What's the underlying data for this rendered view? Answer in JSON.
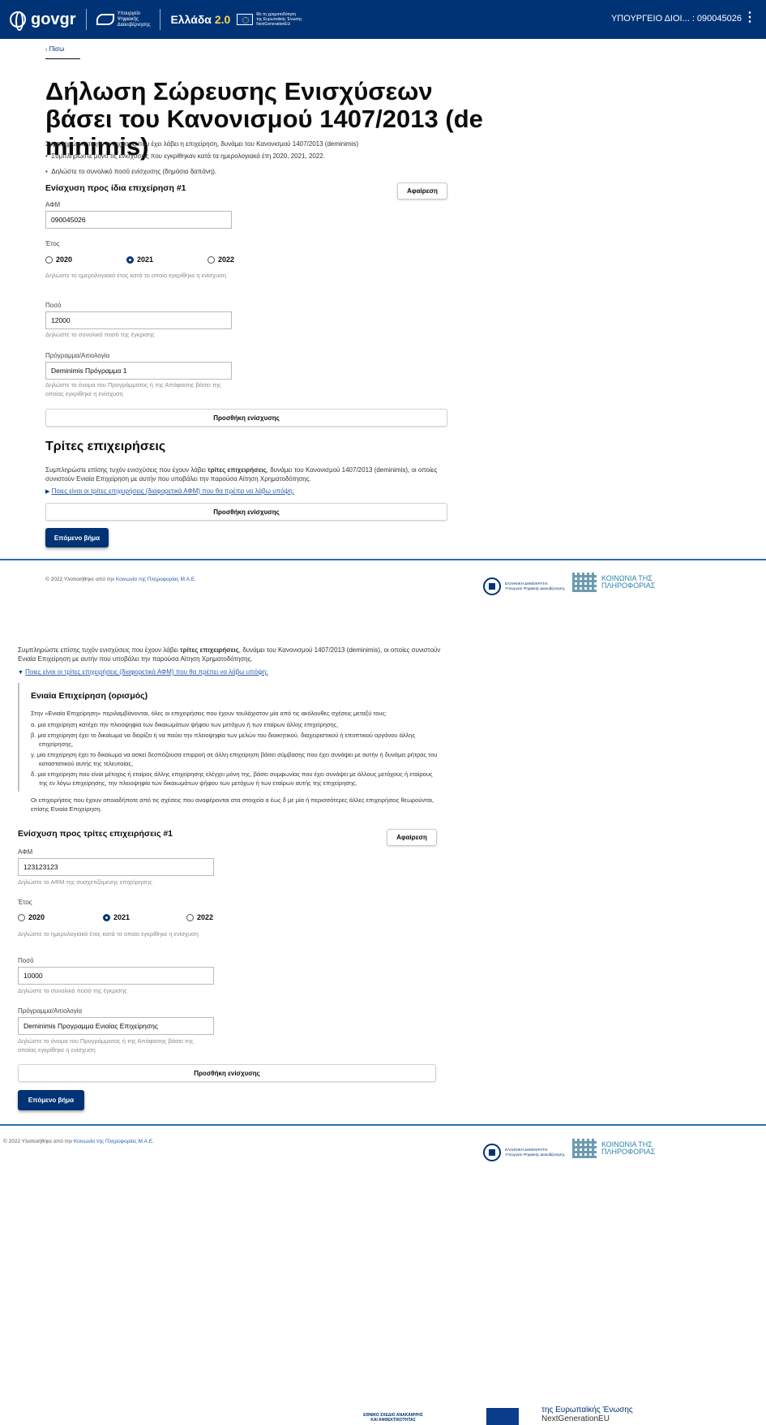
{
  "header": {
    "logo_text": "govgr",
    "mdg_line1": "Υπουργείο",
    "mdg_line2": "Ψηφιακής",
    "mdg_line3": "Διακυβέρνησης",
    "ellada_text": "Ελλάδα",
    "ellada_version": "2.0",
    "eu_line1": "Με τη χρηματοδότηση",
    "eu_line2": "της Ευρωπαϊκής Ένωσης",
    "eu_line3": "NextGenerationEU",
    "user_text": "ΥΠΟΥΡΓΕΙΟ ΔΙΟΙ... : 090045026"
  },
  "back_label": "Πίσω",
  "title": "Δήλωση Σώρευσης Ενισχύσεων βάσει του Κανονισμού 1407/2013 (de minimis)",
  "intro": {
    "text": "Συμπληρώστε τυχόν ενισχύσεις που έχει λάβει η επιχείρηση, δυνάμει του Κανονισμού 1407/2013 (deminimis)",
    "bullets": [
      "Συμπληρώστε μόνο τις ενισχύσεις που εγκρίθηκαν κατά τα ημερολογιακά έτη 2020, 2021, 2022.",
      "Δηλώστε το συνολικό ποσό ενίσχυσης (δημόσια δαπάνη)."
    ]
  },
  "own_aid": {
    "heading": "Ενίσχυση προς ίδια επιχείρηση #1",
    "remove_label": "Αφαίρεση",
    "afm_label": "ΑΦΜ",
    "afm_value": "090045026",
    "year_label": "Έτος",
    "years": [
      "2020",
      "2021",
      "2022"
    ],
    "year_selected": "2021",
    "year_hint": "Δηλώστε το ημερολογιακό έτος κατά το οποίο εγκρίθηκε η ενίσχυση",
    "amount_label": "Ποσό",
    "amount_value": "12000",
    "amount_hint": "Δηλώστε το συνολικό ποσό της έγκρισης",
    "program_label": "Πρόγραμμα/Αιτιολογία",
    "program_value": "Deminimis Πρόγραμμα 1",
    "program_hint": "Δηλώστε το όνομα του Προγράμματος ή της Απόφασης βάσει της οποίας εγκρίθηκε η ενίσχυση",
    "add_label": "Προσθήκη ενίσχυσης"
  },
  "third": {
    "heading": "Τρίτες επιχειρήσεις",
    "text_a": "Συμπληρώστε επίσης τυχόν ενισχύσεις που έχουν λάβει ",
    "text_bold": "τρίτες επιχειρήσεις",
    "text_b": ", δυνάμει του Κανονισμού 1407/2013 (deminimis), οι οποίες συνιστούν Ενιαία Επιχείρηση με αυτήν που υποβάλει την παρούσα Αίτηση Χρηματοδότησης.",
    "link": "Ποιες είναι οι τρίτες επιχειρήσεις (διαφορετικά ΑΦΜ) που θα πρέπει να λάβω υπόψη;",
    "add_label": "Προσθήκη ενίσχυσης"
  },
  "next_label": "Επόμενο βήμα",
  "footer": {
    "text": "© 2022 Υλοποιήθηκε από την ",
    "link": "Κοινωνία της Πληροφορίας Μ.Α.Ε.",
    "hd_line1": "ΕΛΛΗΝΙΚΗ ΔΗΜΟΚΡΑΤΙΑ",
    "hd_line2": "Υπουργείο Ψηφιακής Διακυβέρνησης",
    "kp_line1": "ΚΟΙΝΩΝΙΑ ΤΗΣ",
    "kp_line2": "ΠΛΗΡΟΦΟΡΙΑΣ"
  },
  "definition": {
    "heading": "Ενιαία Επιχείρηση (ορισμός)",
    "intro": "Στην «Ενιαία Επιχείρηση» περιλαμβάνονται, όλες οι επιχειρήσεις που έχουν τουλάχιστον μία από τις ακόλουθες σχέσεις μεταξύ τους:",
    "a": "α. μια επιχείρηση κατέχει την πλειοψηφία των δικαιωμάτων ψήφου των μετόχων ή των εταίρων άλλης επιχείρησης,",
    "b": "β. μια επιχείρηση έχει το δικαίωμα να διορίζει ή να παύει την πλειοψηφία των μελών του διοικητικού, διαχειριστικού ή εποπτικού οργάνου άλλης επιχείρησης,",
    "c": "γ. μια επιχείρηση έχει το δικαίωμα να ασκεί δεσπόζουσα επιρροή σε άλλη επιχείρηση βάσει σύμβασης που έχει συνάψει με αυτήν ή δυνάμει ρήτρας του καταστατικού αυτής της τελευταίας,",
    "d": "δ. μια επιχείρηση που είναι μέτοχος ή εταίρος άλλης επιχείρησης ελέγχει μόνη της, βάσει συμφωνίας που έχει συνάψει με άλλους μετόχους ή εταίρους της εν λόγω επιχείρησης, την πλειοψηφία των δικαιωμάτων ψήφου των μετόχων ή των εταίρων αυτής της επιχείρησης.",
    "outro": "Οι επιχειρήσεις που έχουν οποιαδήποτε από τις σχέσεις που αναφέρονται στα στοιχεία α έως δ με μία ή περισσότερες άλλες επιχειρήσεις θεωρούνται, επίσης Ενιαία Επιχείρηση."
  },
  "third_aid": {
    "heading": "Ενίσχυση προς τρίτες επιχειρήσεις #1",
    "remove_label": "Αφαίρεση",
    "afm_label": "ΑΦΜ",
    "afm_value": "123123123",
    "afm_hint": "Δηλώστε το ΑΦΜ της συσχετιζόμενης επιχείρησης",
    "year_label": "Έτος",
    "years": [
      "2020",
      "2021",
      "2022"
    ],
    "year_selected": "2021",
    "year_hint": "Δηλώστε το ημερολογιακό έτος κατά το οποίο εγκρίθηκε η ενίσχυση",
    "amount_label": "Ποσό",
    "amount_value": "10000",
    "amount_hint": "Δηλώστε το συνολικό ποσό της έγκρισης",
    "program_label": "Πρόγραμμα/Αιτιολογία",
    "program_value": "Deminimis Προγραμμα Ενιαίας Επιχείρησης",
    "program_hint": "Δηλώστε το όνομα του Προγράμματος ή της Απόφασης βάσει της οποίας εγκρίθηκε η ενίσχυση",
    "add_label": "Προσθήκη ενίσχυσης"
  },
  "bottom": {
    "rrf_line1": "ΕΘΝΙΚΟ ΣΧΕΔΙΟ ΑΝΑΚΑΜΨΗΣ",
    "rrf_line2": "ΚΑΙ ΑΝΘΕΚΤΙΚΟΤΗΤΑΣ",
    "eu_line": "της Ευρωπαϊκής Ένωσης",
    "eu_sub": "NextGenerationEU"
  }
}
